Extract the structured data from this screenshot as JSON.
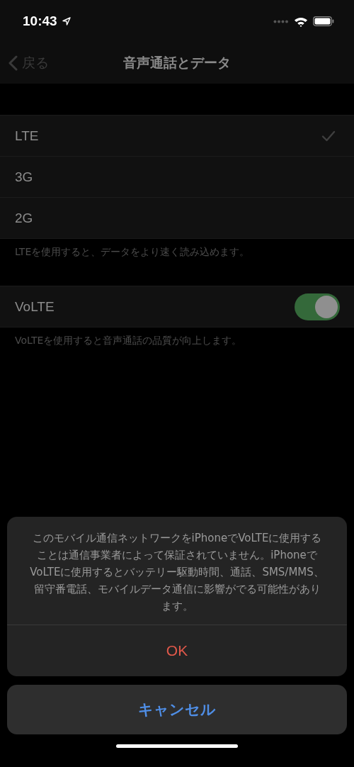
{
  "status_bar": {
    "time": "10:43"
  },
  "nav": {
    "back": "戻る",
    "title": "音声通話とデータ"
  },
  "networks": [
    {
      "label": "LTE",
      "selected": true
    },
    {
      "label": "3G",
      "selected": false
    },
    {
      "label": "2G",
      "selected": false
    }
  ],
  "networks_footer": "LTEを使用すると、データをより速く読み込めます。",
  "volte": {
    "label": "VoLTE",
    "on": true,
    "footer": "VoLTEを使用すると音声通話の品質が向上します。"
  },
  "action_sheet": {
    "message": "このモバイル通信ネットワークをiPhoneでVoLTEに使用することは通信事業者によって保証されていません。iPhoneでVoLTEに使用するとバッテリー駆動時間、通話、SMS/MMS、留守番電話、モバイルデータ通信に影響がでる可能性があります。",
    "ok": "OK",
    "cancel": "キャンセル"
  }
}
